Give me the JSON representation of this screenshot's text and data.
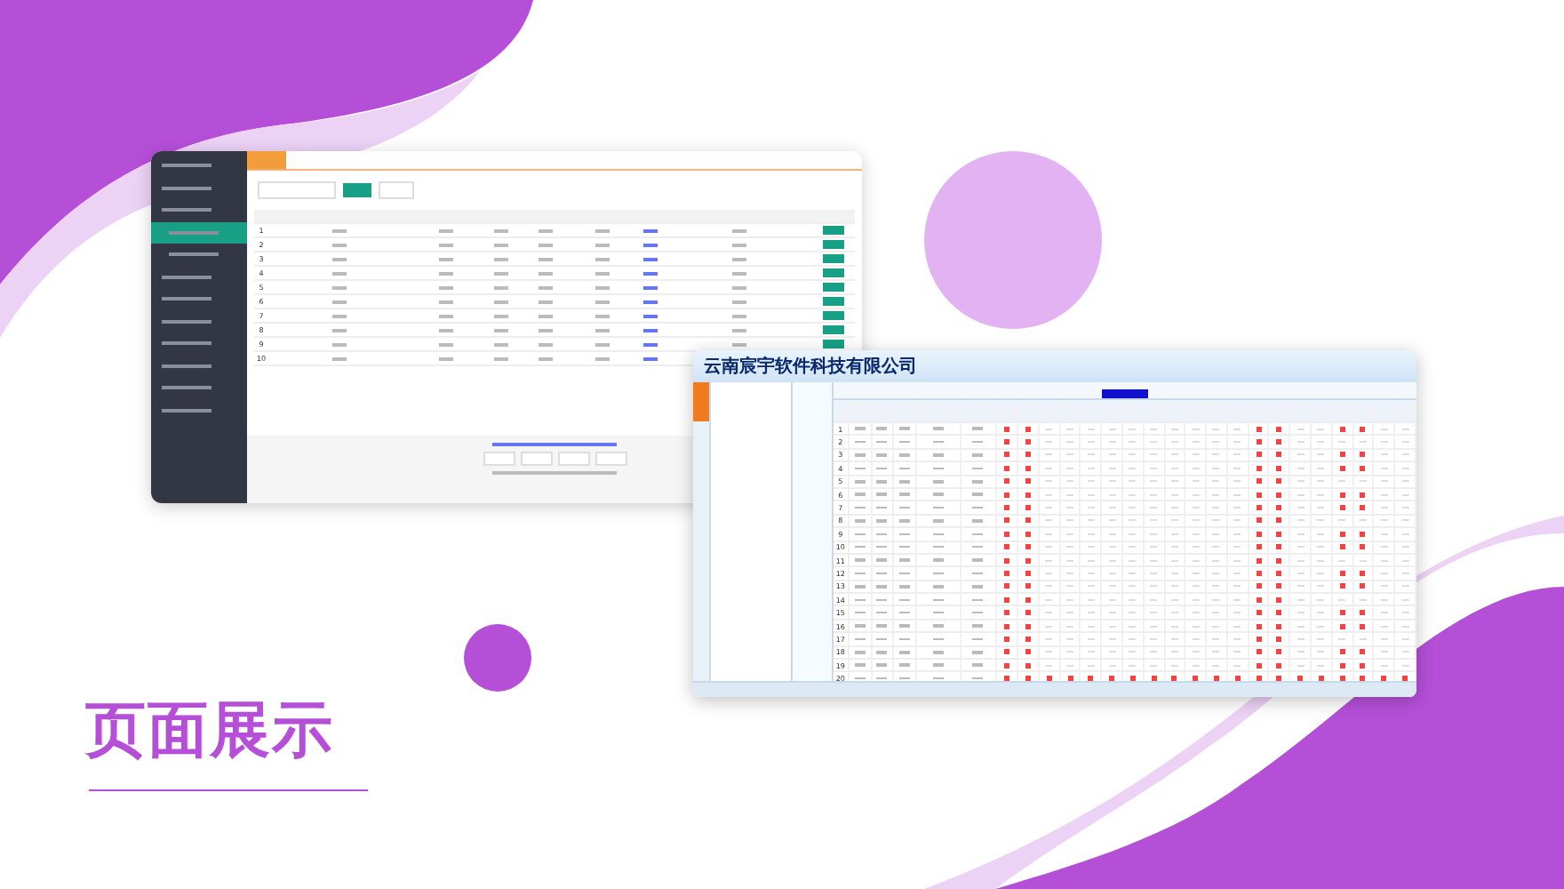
{
  "heading": "页面展示",
  "screen_1": {
    "sidebar": [
      {
        "kind": "group",
        "selected": false
      },
      {
        "kind": "group",
        "selected": false
      },
      {
        "kind": "group",
        "selected": false
      },
      {
        "kind": "sub",
        "selected": true
      },
      {
        "kind": "sub",
        "selected": false
      },
      {
        "kind": "group",
        "selected": false
      },
      {
        "kind": "group",
        "selected": false
      },
      {
        "kind": "group",
        "selected": false
      },
      {
        "kind": "group",
        "selected": false
      },
      {
        "kind": "group",
        "selected": false
      },
      {
        "kind": "group",
        "selected": false
      },
      {
        "kind": "group",
        "selected": false
      }
    ],
    "rows": [
      "1",
      "2",
      "3",
      "4",
      "5",
      "6",
      "7",
      "8",
      "9",
      "10"
    ]
  },
  "screen_2": {
    "company": "云南宸宇软件科技有限公司",
    "rows": [
      "1",
      "2",
      "3",
      "4",
      "5",
      "6",
      "7",
      "8",
      "9",
      "10",
      "11",
      "12",
      "13",
      "14",
      "15",
      "16",
      "17",
      "18",
      "19",
      "20"
    ]
  }
}
